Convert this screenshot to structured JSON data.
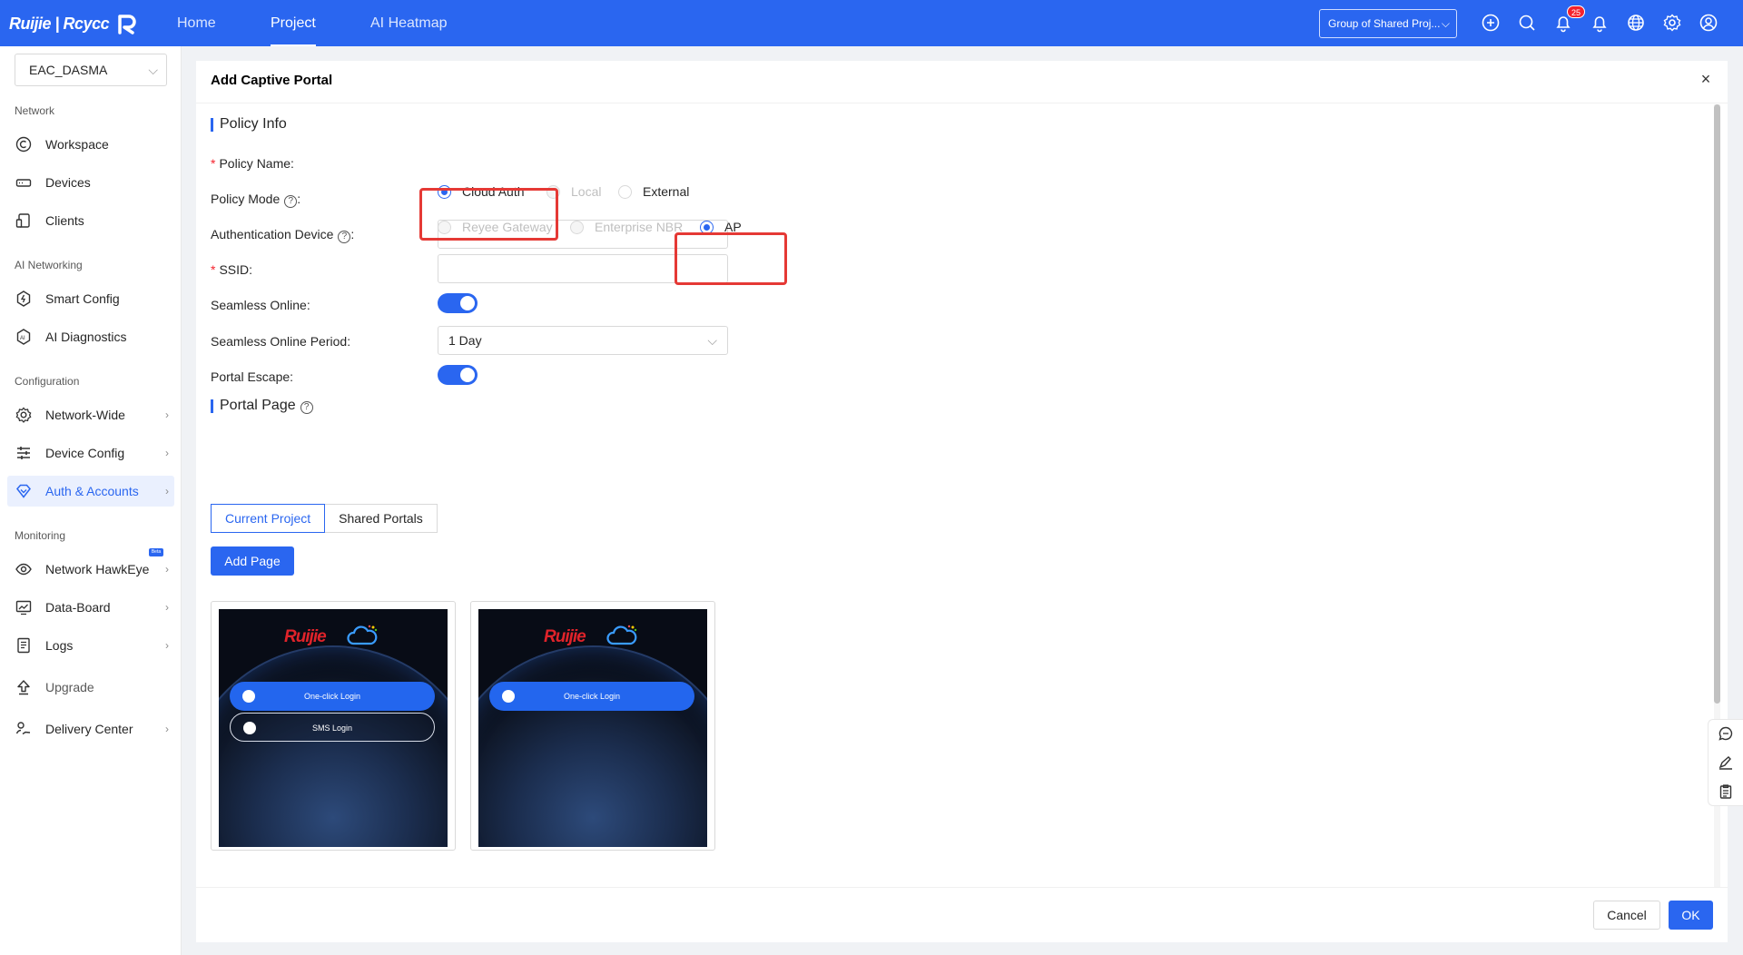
{
  "topbar": {
    "logo_text": "Ruijie | Rcycc",
    "nav": [
      "Home",
      "Project",
      "AI Heatmap"
    ],
    "active_nav": "Project",
    "group_select": "Group of Shared Proj...",
    "notification_count": "25"
  },
  "sidebar": {
    "project": "EAC_DASMA",
    "sections": {
      "network": "Network",
      "ai_networking": "AI Networking",
      "configuration": "Configuration",
      "monitoring": "Monitoring"
    },
    "items": {
      "workspace": "Workspace",
      "devices": "Devices",
      "clients": "Clients",
      "smart_config": "Smart Config",
      "ai_diagnostics": "AI Diagnostics",
      "network_wide": "Network-Wide",
      "device_config": "Device Config",
      "auth_accounts": "Auth & Accounts",
      "network_hawkeye": "Network HawkEye",
      "data_board": "Data-Board",
      "logs": "Logs",
      "upgrade": "Upgrade",
      "delivery_center": "Delivery Center"
    },
    "beta_badge": "Beta"
  },
  "modal": {
    "title": "Add Captive Portal",
    "close": "×",
    "policy_info": {
      "section_title": "Policy Info",
      "policy_name_label": "Policy Name",
      "policy_name_value": "",
      "policy_mode_label": "Policy Mode",
      "policy_mode_options": [
        "Cloud Auth",
        "Local",
        "External"
      ],
      "policy_mode_selected": "Cloud Auth",
      "auth_device_label": "Authentication Device",
      "auth_device_options": [
        "Reyee Gateway",
        "Enterprise NBR",
        "AP"
      ],
      "auth_device_selected": "AP",
      "ssid_label": "SSID",
      "ssid_value": "",
      "seamless_online_label": "Seamless Online",
      "seamless_online_enabled": true,
      "seamless_period_label": "Seamless Online Period",
      "seamless_period_value": "1 Day",
      "portal_escape_label": "Portal Escape",
      "portal_escape_enabled": true
    },
    "portal_page": {
      "section_title": "Portal Page",
      "tabs": [
        "Current Project",
        "Shared Portals"
      ],
      "active_tab": "Current Project",
      "add_page_label": "Add Page",
      "cards": [
        {
          "brand": "Ruijie",
          "buttons": [
            "One-click Login",
            "SMS Login"
          ]
        },
        {
          "brand": "Ruijie",
          "buttons": [
            "One-click Login"
          ]
        }
      ]
    },
    "footer": {
      "cancel_label": "Cancel",
      "ok_label": "OK"
    }
  },
  "colors": {
    "brand_blue": "#2a66f0",
    "highlight_red": "#e53935"
  }
}
